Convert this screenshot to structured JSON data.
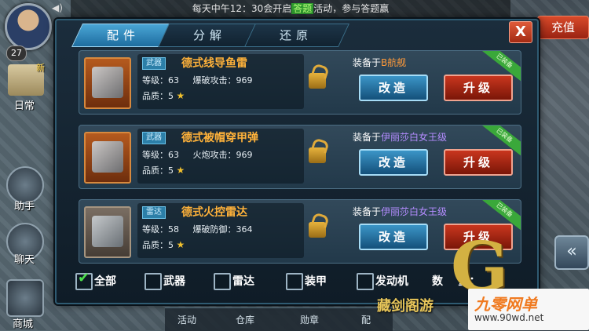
{
  "topbar": {
    "prefix": "每天中午12：30会开启",
    "highlight": "答题",
    "suffix": "活动，参与答题赢"
  },
  "player": {
    "level": "27"
  },
  "side": {
    "daily": "日常",
    "daily_badge": "新",
    "helper": "助手",
    "chat": "聊天",
    "shop": "商城"
  },
  "recharge": "充值",
  "tabs": [
    {
      "label": "配件"
    },
    {
      "label": "分解"
    },
    {
      "label": "还原"
    }
  ],
  "close": "X",
  "items": [
    {
      "tag": "武器",
      "name": "德式线导鱼雷",
      "level_label": "等级：",
      "level": "63",
      "stat_label": "爆破攻击：",
      "stat": "969",
      "quality_label": "品质：",
      "quality": "5",
      "equip_label": "装备于",
      "equip_ship": "B航舰",
      "badge": "已装备",
      "btn_modify": "改造",
      "btn_upgrade": "升级"
    },
    {
      "tag": "武器",
      "name": "德式被帽穿甲弹",
      "level_label": "等级：",
      "level": "63",
      "stat_label": "火炮攻击：",
      "stat": "969",
      "quality_label": "品质：",
      "quality": "5",
      "equip_label": "装备于",
      "equip_ship": "伊丽莎白女王级",
      "badge": "已装备",
      "btn_modify": "改造",
      "btn_upgrade": "升级"
    },
    {
      "tag": "雷达",
      "name": "德式火控雷达",
      "level_label": "等级：",
      "level": "58",
      "stat_label": "爆破防御：",
      "stat": "364",
      "quality_label": "品质：",
      "quality": "5",
      "equip_label": "装备于",
      "equip_ship": "伊丽莎白女王级",
      "badge": "已装备",
      "btn_modify": "改造",
      "btn_upgrade": "升级"
    }
  ],
  "filters": {
    "all": "全部",
    "weapon": "武器",
    "radar": "雷达",
    "armor": "装甲",
    "engine": "发动机",
    "count_label": "数    量："
  },
  "bottom": {
    "activity": "活动",
    "warehouse": "仓库",
    "medal": "勋章",
    "config": "配"
  },
  "watermark": {
    "letter": "G",
    "text": "藏剑阁游"
  },
  "logo": {
    "line1": "九零网单",
    "line2": "www.90wd.net"
  }
}
